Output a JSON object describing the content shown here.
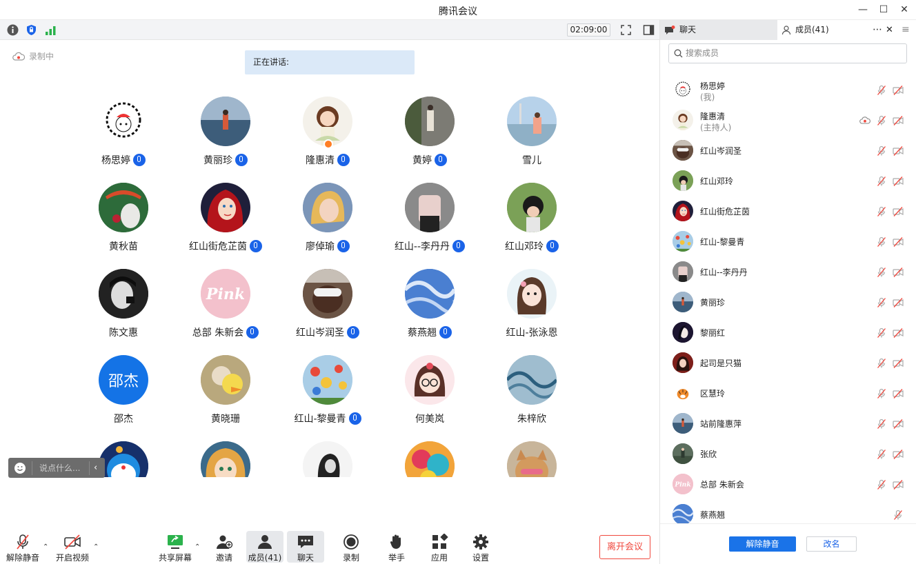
{
  "window": {
    "title": "腾讯会议"
  },
  "toolbar": {
    "timer": "02:09:00"
  },
  "recording": {
    "label": "录制中"
  },
  "speaking": {
    "label": "正在讲话:"
  },
  "participants": [
    {
      "name": "杨思婷",
      "mic": true,
      "avatar": "doodle"
    },
    {
      "name": "黄丽珍",
      "mic": true,
      "avatar": "photo-lake"
    },
    {
      "name": "隆惠清",
      "mic": true,
      "avatar": "girl-illustration",
      "host": true
    },
    {
      "name": "黄婷",
      "mic": true,
      "avatar": "photo-street"
    },
    {
      "name": "雪儿",
      "mic": false,
      "avatar": "photo-sea"
    },
    {
      "name": "黄秋苗",
      "mic": false,
      "avatar": "totoro"
    },
    {
      "name": "红山街危芷茵",
      "mic": true,
      "avatar": "mermaid"
    },
    {
      "name": "廖倬瑜",
      "mic": true,
      "avatar": "painting"
    },
    {
      "name": "红山--李丹丹",
      "mic": true,
      "avatar": "photo-hands"
    },
    {
      "name": "红山邓玲",
      "mic": true,
      "avatar": "photo-child"
    },
    {
      "name": "陈文惠",
      "mic": false,
      "avatar": "bw-portrait"
    },
    {
      "name": "总部 朱新会",
      "mic": true,
      "avatar": "pink"
    },
    {
      "name": "红山岑润圣",
      "mic": true,
      "avatar": "photo-glasses"
    },
    {
      "name": "蔡燕翘",
      "mic": true,
      "avatar": "sky"
    },
    {
      "name": "红山-张泳恩",
      "mic": false,
      "avatar": "cartoon-girl"
    },
    {
      "name": "邵杰",
      "mic": false,
      "avatar": "text",
      "initials": "邵杰"
    },
    {
      "name": "黄晓珊",
      "mic": false,
      "avatar": "duck"
    },
    {
      "name": "红山-黎曼青",
      "mic": true,
      "avatar": "flowers"
    },
    {
      "name": "何美岚",
      "mic": false,
      "avatar": "glasses-girl"
    },
    {
      "name": "朱梓欣",
      "mic": false,
      "avatar": "waves"
    },
    {
      "name": "",
      "mic": false,
      "avatar": "doraemon"
    },
    {
      "name": "",
      "mic": false,
      "avatar": "anime"
    },
    {
      "name": "",
      "mic": false,
      "avatar": "bw-girl"
    },
    {
      "name": "",
      "mic": false,
      "avatar": "colorful"
    },
    {
      "name": "",
      "mic": false,
      "avatar": "cat"
    }
  ],
  "chatbox": {
    "placeholder": "说点什么..."
  },
  "bottombar": {
    "unmute": "解除静音",
    "video": "开启视频",
    "share": "共享屏幕",
    "invite": "邀请",
    "members": "成员(41)",
    "chat": "聊天",
    "record": "录制",
    "raise": "举手",
    "apps": "应用",
    "settings": "设置",
    "leave": "离开会议"
  },
  "panel": {
    "tab_chat": "聊天",
    "tab_members": "成员(41)",
    "search_placeholder": "搜索成员",
    "members": [
      {
        "name": "杨思婷",
        "sub": "(我)",
        "avatar": "doodle",
        "cam": true
      },
      {
        "name": "隆惠清",
        "sub": "(主持人)",
        "avatar": "girl-illustration",
        "cam": true,
        "rec": true
      },
      {
        "name": "红山岑润圣",
        "sub": "",
        "avatar": "photo-glasses",
        "cam": true
      },
      {
        "name": "红山邓玲",
        "sub": "",
        "avatar": "photo-child",
        "cam": true
      },
      {
        "name": "红山街危芷茵",
        "sub": "",
        "avatar": "mermaid",
        "cam": true
      },
      {
        "name": "红山-黎曼青",
        "sub": "",
        "avatar": "flowers",
        "cam": true
      },
      {
        "name": "红山--李丹丹",
        "sub": "",
        "avatar": "photo-hands",
        "cam": true
      },
      {
        "name": "黄丽珍",
        "sub": "",
        "avatar": "photo-lake",
        "cam": true
      },
      {
        "name": "黎丽红",
        "sub": "",
        "avatar": "dark-face",
        "cam": true
      },
      {
        "name": "起司是只猫",
        "sub": "",
        "avatar": "red-girl",
        "cam": true
      },
      {
        "name": "区慧玲",
        "sub": "",
        "avatar": "tiger",
        "cam": true
      },
      {
        "name": "站前隆惠萍",
        "sub": "",
        "avatar": "photo-lake",
        "cam": true
      },
      {
        "name": "张欣",
        "sub": "",
        "avatar": "photo-green",
        "cam": true
      },
      {
        "name": "总部 朱新会",
        "sub": "",
        "avatar": "pink",
        "cam": true
      },
      {
        "name": "蔡燕翘",
        "sub": "",
        "avatar": "sky",
        "cam": false
      }
    ],
    "unmute_btn": "解除静音",
    "rename_btn": "改名"
  },
  "colors": {
    "accent": "#1a63e8",
    "danger": "#f0483e"
  }
}
